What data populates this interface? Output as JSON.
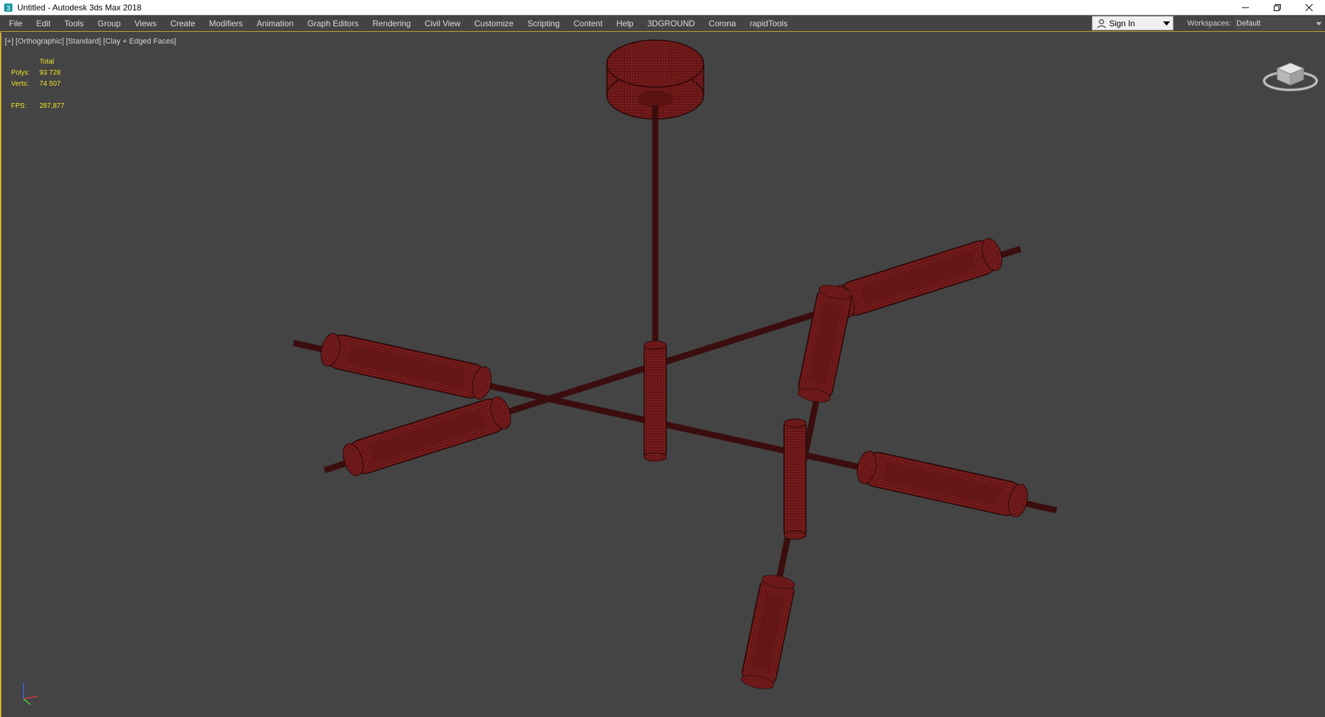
{
  "window": {
    "title": "Untitled - Autodesk 3ds Max 2018",
    "icon": "3ds-max-app-icon",
    "controls": [
      "minimize-icon",
      "restore-icon",
      "close-icon"
    ]
  },
  "menubar": {
    "items": [
      "File",
      "Edit",
      "Tools",
      "Group",
      "Views",
      "Create",
      "Modifiers",
      "Animation",
      "Graph Editors",
      "Rendering",
      "Civil View",
      "Customize",
      "Scripting",
      "Content",
      "Help",
      "3DGROUND",
      "Corona",
      "rapidTools"
    ],
    "sign_in": {
      "label": "Sign In",
      "icon": "user-icon"
    },
    "workspaces": {
      "label": "Workspaces:",
      "value": "Default"
    }
  },
  "viewport": {
    "labels": [
      "[+]",
      "[Orthographic]",
      "[Standard]",
      "[Clay + Edged Faces]"
    ],
    "stats": {
      "total_label": "Total",
      "polys_label": "Polys:",
      "polys_value": "93 728",
      "verts_label": "Verts:",
      "verts_value": "74 507",
      "fps_label": "FPS:",
      "fps_value": "287,877"
    },
    "colors": {
      "background": "#444444",
      "model_fill": "#7a1c1c",
      "model_edge": "#2a0808",
      "rod": "#3b0d0d",
      "stats_text": "#f2e52a",
      "active_border": "#d4b033"
    },
    "scene_object": "ceiling-chandelier-model",
    "widgets": [
      "viewcube-icon",
      "axis-tripod-icon"
    ]
  }
}
